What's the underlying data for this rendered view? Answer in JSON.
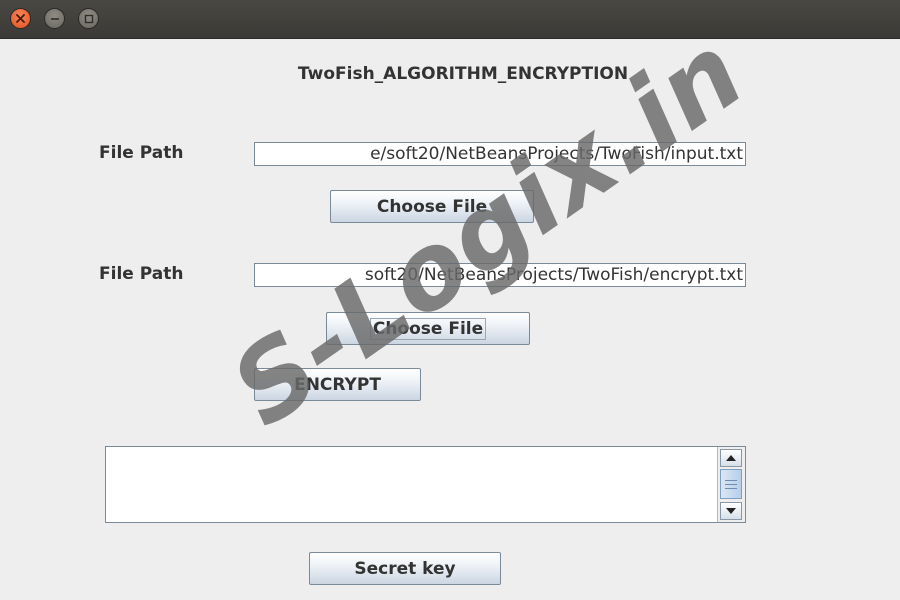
{
  "window": {
    "controls": {
      "close_icon": "close-icon",
      "minimize_icon": "minimize-icon",
      "maximize_icon": "maximize-icon"
    }
  },
  "main": {
    "heading": "TwoFish_ALGORITHM_ENCRYPTION",
    "input_file": {
      "label": "File Path",
      "value": "e/soft20/NetBeansProjects/TwoFish/input.txt",
      "button": "Choose File"
    },
    "output_file": {
      "label": "File Path",
      "value": "soft20/NetBeansProjects/TwoFish/encrypt.txt",
      "button": "Choose File"
    },
    "encrypt_button": "ENCRYPT",
    "output_text": "",
    "secret_key_button": "Secret key"
  },
  "watermark": "S-Logix.in",
  "colors": {
    "titlebar": "#3e3d39",
    "close": "#e9592a",
    "background": "#eeeeee"
  }
}
